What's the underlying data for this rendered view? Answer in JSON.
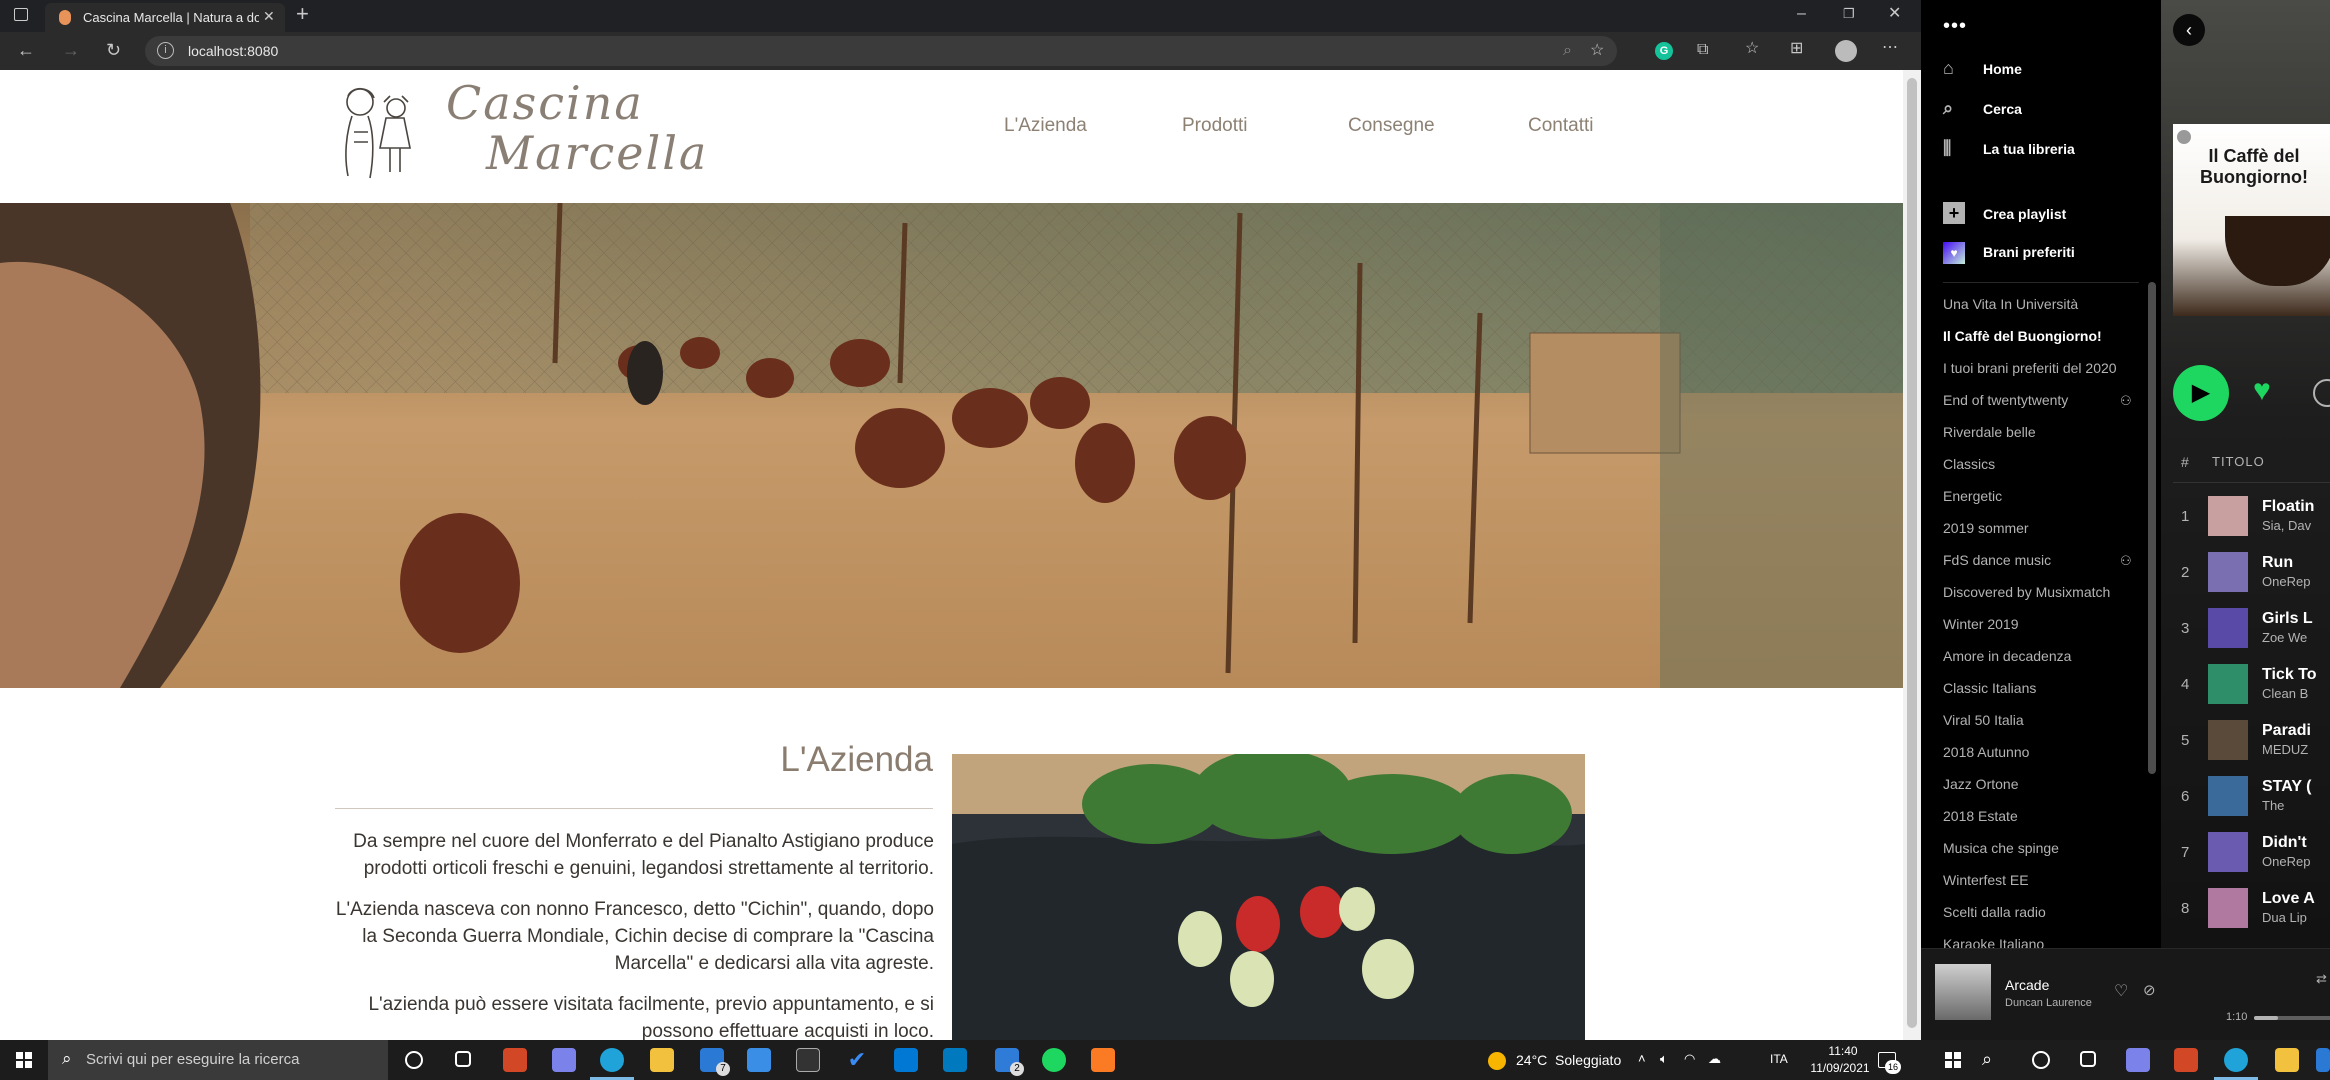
{
  "browser": {
    "tab_title": "Cascina Marcella | Natura a domicilio",
    "address": "localhost:8080"
  },
  "site": {
    "logo_line1": "Cascina",
    "logo_line2": "Marcella",
    "menu": [
      "L'Azienda",
      "Prodotti",
      "Consegne",
      "Contatti"
    ],
    "section_title": "L'Azienda",
    "paragraphs": [
      "Da sempre nel cuore del Monferrato e del Pianalto Astigiano produce prodotti orticoli freschi e genuini, legandosi strettamente al territorio.",
      "L'Azienda nasceva con nonno Francesco, detto \"Cichin\", quando, dopo la Seconda Guerra Mondiale, Cichin decise di comprare la \"Cascina Marcella\" e dedicarsi alla vita agreste.",
      "L'azienda può essere visitata facilmente, previo appuntamento, e si possono effettuare acquisti in loco."
    ]
  },
  "spotify": {
    "nav": [
      {
        "label": "Home",
        "icon": "home-icon"
      },
      {
        "label": "Cerca",
        "icon": "search-icon"
      },
      {
        "label": "La tua libreria",
        "icon": "library-icon"
      }
    ],
    "create_playlist": "Crea playlist",
    "liked_songs": "Brani preferiti",
    "playlists": [
      "Una Vita In Università",
      "Il Caffè del Buongiorno!",
      "I tuoi brani preferiti del 2020",
      "End of twentytwenty",
      "Riverdale belle",
      "Classics",
      "Energetic",
      "2019 sommer",
      "FdS dance music",
      "Discovered by Musixmatch",
      "Winter 2019",
      "Amore in decadenza",
      "Classic Italians",
      "Viral 50 Italia",
      "2018 Autunno",
      "Jazz Ortone",
      "2018 Estate",
      "Musica che spinge",
      "Winterfest EE",
      "Scelti dalla radio",
      "Karaoke Italiano"
    ],
    "active_playlist": "Il Caffè del Buongiorno!",
    "cover_title": "Il Caffè del Buongiorno!",
    "column_hash": "#",
    "column_title": "TITOLO",
    "tracks": [
      {
        "n": "1",
        "title": "Floatin",
        "artist": "Sia, Dav"
      },
      {
        "n": "2",
        "title": "Run",
        "artist": "OneRep"
      },
      {
        "n": "3",
        "title": "Girls L",
        "artist": "Zoe We"
      },
      {
        "n": "4",
        "title": "Tick To",
        "artist": "Clean B"
      },
      {
        "n": "5",
        "title": "Paradi",
        "artist": "MEDUZ"
      },
      {
        "n": "6",
        "title": "STAY (",
        "artist": "The"
      },
      {
        "n": "7",
        "title": "Didn't",
        "artist": "OneRep"
      },
      {
        "n": "8",
        "title": "Love A",
        "artist": "Dua Lip"
      }
    ],
    "now_playing": {
      "title": "Arcade",
      "artist": "Duncan Laurence",
      "time": "1:10"
    }
  },
  "taskbar": {
    "search_placeholder": "Scrivi qui per eseguire la ricerca",
    "weather": "24°C  Soleggiato",
    "lang": "ITA",
    "time": "11:40",
    "date": "11/09/2021",
    "notif": "16",
    "mail_badge": "7",
    "docs_badge": "2"
  }
}
